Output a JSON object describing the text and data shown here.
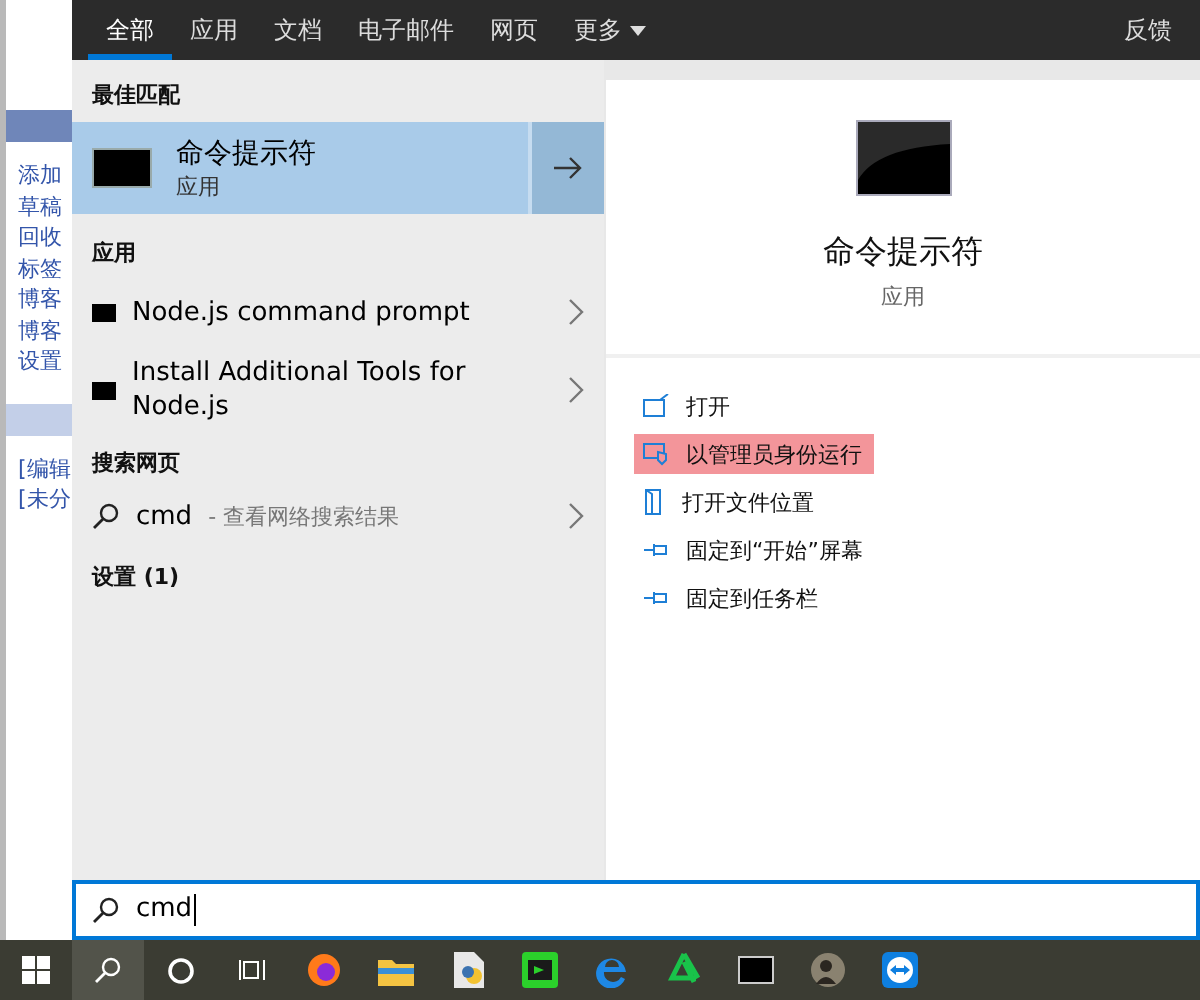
{
  "background_page": {
    "links": [
      "添加",
      "草稿",
      "回收",
      "标签",
      "博客",
      "博客",
      "设置"
    ],
    "section_links": [
      "[编辑",
      "[未分"
    ]
  },
  "tabs": [
    {
      "label": "全部",
      "selected": true,
      "kind": "plain"
    },
    {
      "label": "应用",
      "selected": false,
      "kind": "plain"
    },
    {
      "label": "文档",
      "selected": false,
      "kind": "plain"
    },
    {
      "label": "电子邮件",
      "selected": false,
      "kind": "plain"
    },
    {
      "label": "网页",
      "selected": false,
      "kind": "plain"
    },
    {
      "label": "更多",
      "selected": false,
      "kind": "dropdown"
    }
  ],
  "feedback_button": "反馈",
  "best_match": {
    "heading": "最佳匹配",
    "title": "命令提示符",
    "subtitle": "应用",
    "selected": true
  },
  "apps": {
    "heading": "应用",
    "items": [
      {
        "label": "Node.js command prompt"
      },
      {
        "label": "Install Additional Tools for Node.js"
      }
    ]
  },
  "web": {
    "heading": "搜索网页",
    "query": "cmd",
    "hint": "- 查看网络搜索结果"
  },
  "settings_heading": "设置 (1)",
  "details": {
    "title": "命令提示符",
    "subtitle": "应用",
    "actions": [
      {
        "label": "打开",
        "kind": "open",
        "highlighted": false
      },
      {
        "label": "以管理员身份运行",
        "kind": "admin",
        "highlighted": true
      },
      {
        "label": "打开文件位置",
        "kind": "folder",
        "highlighted": false
      },
      {
        "label": "固定到“开始”屏幕",
        "kind": "pin",
        "highlighted": false
      },
      {
        "label": "固定到任务栏",
        "kind": "pin",
        "highlighted": false
      }
    ]
  },
  "search": {
    "value": "cmd"
  }
}
